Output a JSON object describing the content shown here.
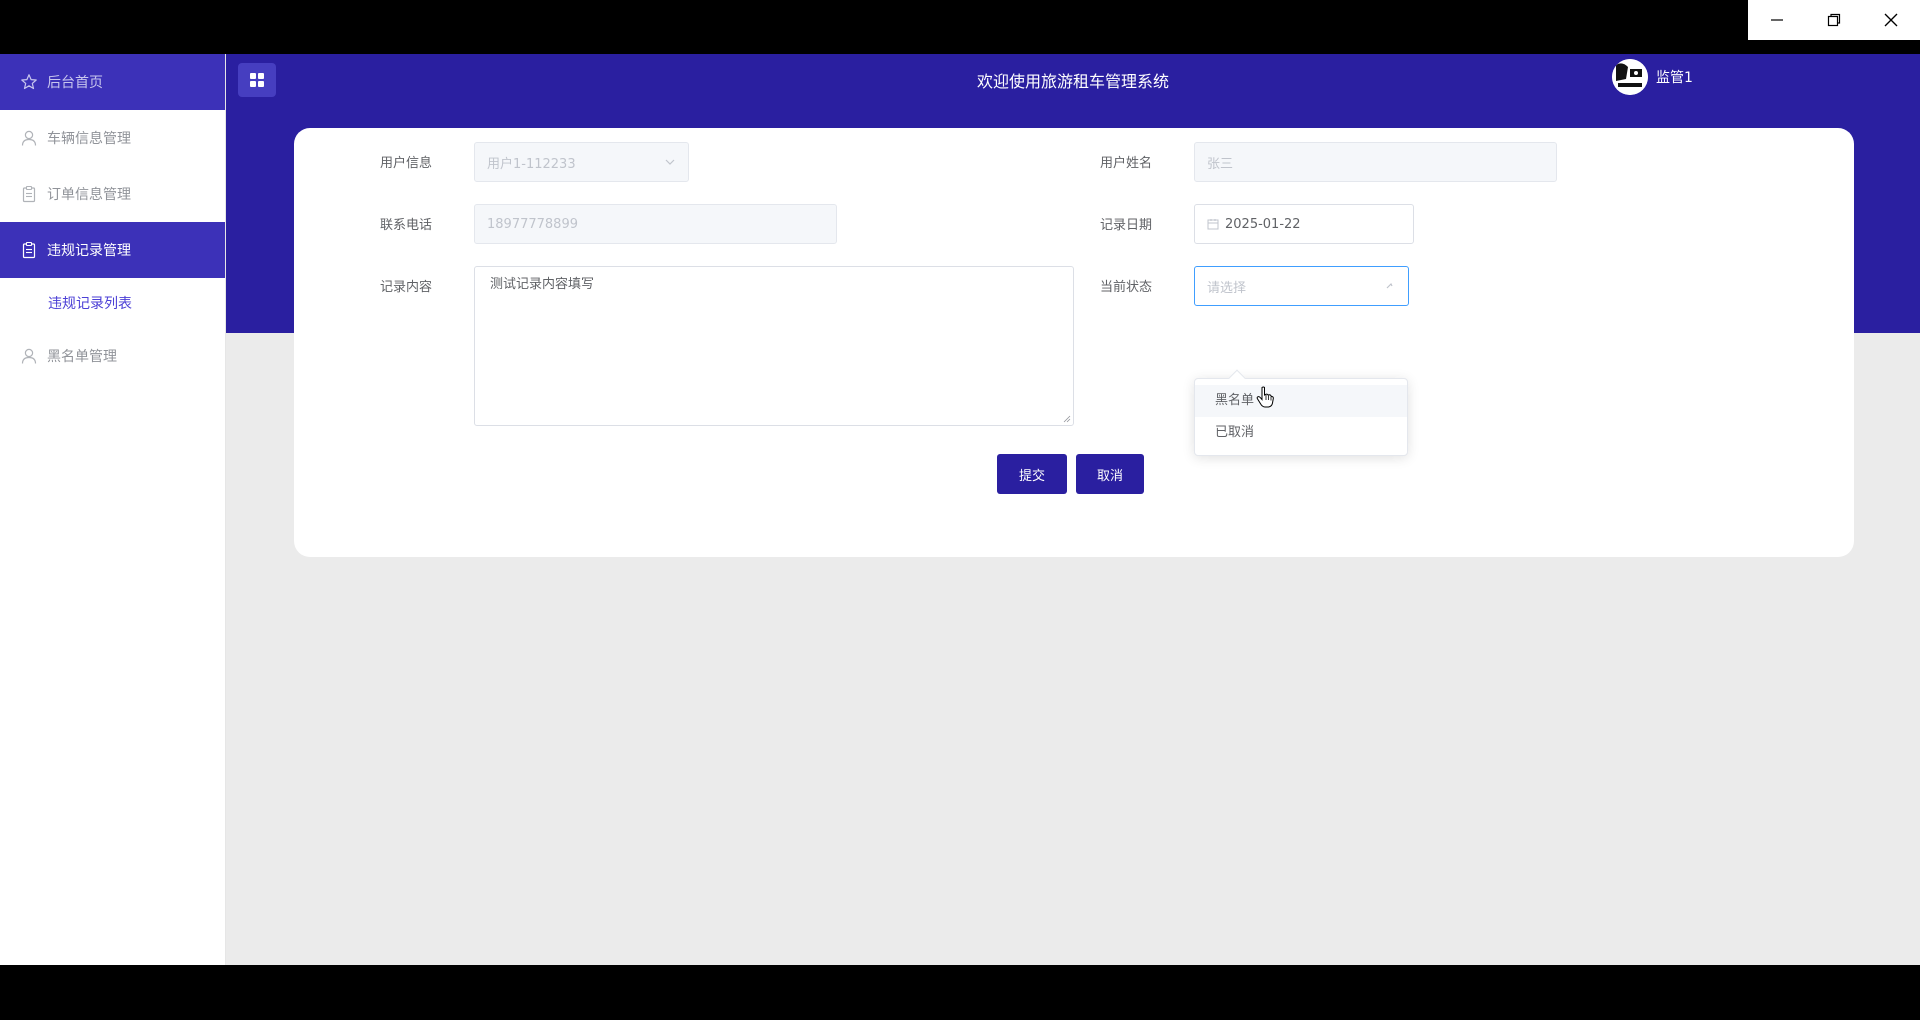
{
  "window": {
    "minimize_icon": "minimize-icon",
    "restore_icon": "restore-icon",
    "close_icon": "close-icon"
  },
  "header": {
    "title": "欢迎使用旅游租车管理系统",
    "username": "监管1"
  },
  "sidebar": {
    "items": [
      {
        "label": "后台首页",
        "icon": "star-icon"
      },
      {
        "label": "车辆信息管理",
        "icon": "user-icon"
      },
      {
        "label": "订单信息管理",
        "icon": "clipboard-icon"
      },
      {
        "label": "违规记录管理",
        "icon": "clipboard-icon"
      },
      {
        "label": "违规记录列表"
      },
      {
        "label": "黑名单管理",
        "icon": "user-icon"
      }
    ]
  },
  "form": {
    "user_info": {
      "label": "用户信息",
      "value": "用户1-112233"
    },
    "user_name": {
      "label": "用户姓名",
      "value": "张三"
    },
    "phone": {
      "label": "联系电话",
      "value": "18977778899"
    },
    "record_date": {
      "label": "记录日期",
      "value": "2025-01-22"
    },
    "content": {
      "label": "记录内容",
      "value": "测试记录内容填写"
    },
    "status": {
      "label": "当前状态",
      "placeholder": "请选择"
    },
    "submit_label": "提交",
    "cancel_label": "取消"
  },
  "status_dropdown": {
    "options": [
      "黑名单",
      "已取消"
    ]
  }
}
